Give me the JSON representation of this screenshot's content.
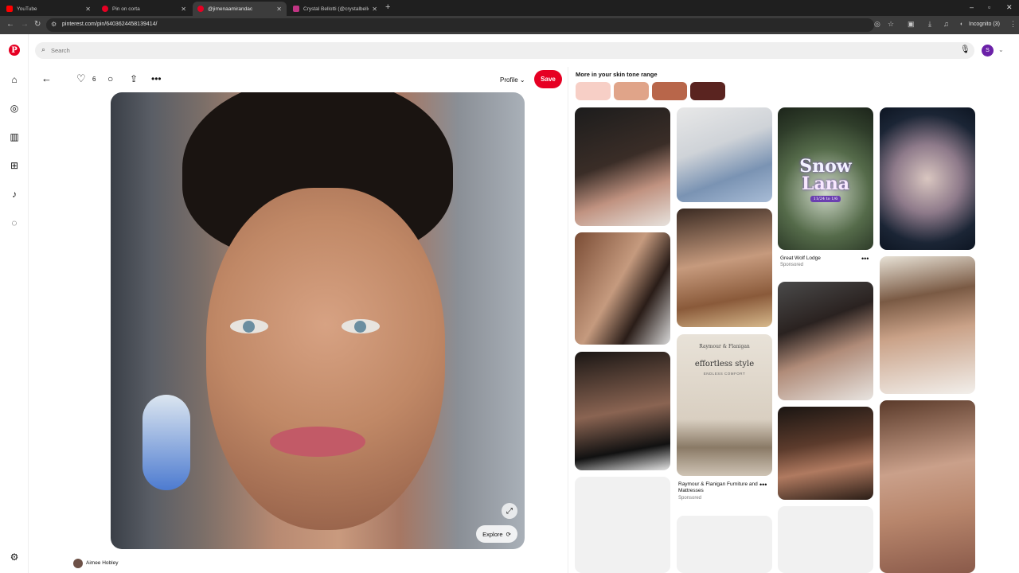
{
  "browser": {
    "tabs": [
      {
        "title": "YouTube",
        "color": "#ff0000"
      },
      {
        "title": "Pin on corta",
        "color": "#e60023"
      },
      {
        "title": "@jimenaamirandac",
        "color": "#e60023"
      },
      {
        "title": "Crystal Bellotti (@crystalbellotti",
        "color": "#c13584"
      }
    ],
    "url": "pinterest.com/pin/6403624458139414/",
    "incognito_label": "Incognito (3)"
  },
  "search": {
    "placeholder": "Search"
  },
  "account": {
    "initial": "S"
  },
  "pin": {
    "likes": "6",
    "profile_label": "Profile",
    "save_label": "Save",
    "explore_label": "Explore",
    "creator": "Aimee Hobley"
  },
  "related": {
    "title": "More in your skin tone range",
    "swatches": [
      "#f7cfc6",
      "#e0a489",
      "#b8664a",
      "#5a2420"
    ],
    "sponsored": [
      {
        "name": "Great Wolf Lodge",
        "label": "Sponsored"
      },
      {
        "name": "Raymour & Flanigan Furniture and Mattresses",
        "label": "Sponsored"
      }
    ],
    "snow_ad": {
      "line1": "Snow",
      "line2": "Lana",
      "dates": "11/24 to 1/6"
    },
    "furniture_ad": {
      "brand": "Raymour & Flanigan",
      "headline": "effortless style",
      "tagline": "ENDLESS COMFORT"
    }
  }
}
